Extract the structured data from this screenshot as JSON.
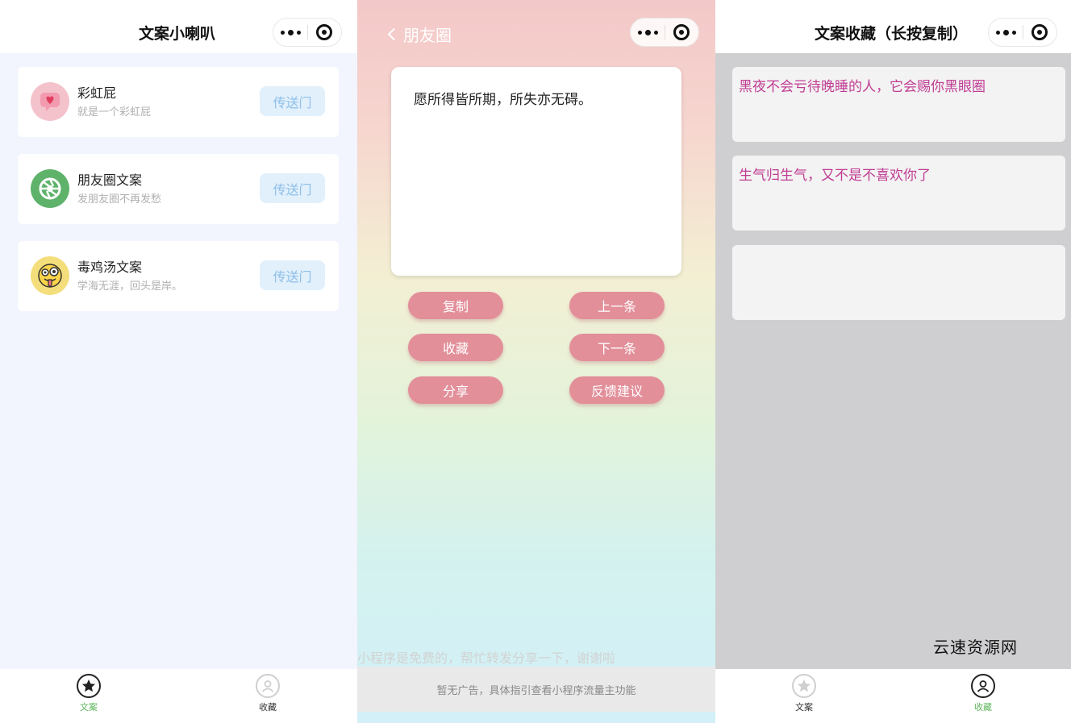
{
  "panel_home": {
    "nav_title": "文案小喇叭",
    "cards": [
      {
        "name": "彩虹屁",
        "desc": "就是一个彩虹屁",
        "button": "传送门",
        "icon": "heart-chat-icon"
      },
      {
        "name": "朋友圈文案",
        "desc": "发朋友圈不再发愁",
        "button": "传送门",
        "icon": "aperture-icon"
      },
      {
        "name": "毒鸡汤文案",
        "desc": "学海无涯，回头是岸。",
        "button": "传送门",
        "icon": "crazy-face-icon"
      }
    ],
    "tabs": [
      {
        "label": "文案",
        "icon": "star-circle-icon",
        "active": true
      },
      {
        "label": "收藏",
        "icon": "user-circle-icon",
        "active": false
      }
    ]
  },
  "panel_moments": {
    "back_label": "朋友圈",
    "quote": "愿所得皆所期，所失亦无碍。",
    "buttons": {
      "copy": "复制",
      "prev": "上一条",
      "favorite": "收藏",
      "next": "下一条",
      "share": "分享",
      "feedback": "反馈建议"
    },
    "share_hint": "小程序是免费的，帮忙转发分享一下，谢谢啦",
    "ad_text": "暂无广告，具体指引查看小程序流量主功能"
  },
  "panel_favorites": {
    "nav_title": "文案收藏（长按复制）",
    "items": [
      "黑夜不会亏待晚睡的人，它会赐你黑眼圈",
      "生气归生气，又不是不喜欢你了",
      ""
    ],
    "tabs": [
      {
        "label": "文案",
        "icon": "star-circle-icon",
        "active": false
      },
      {
        "label": "收藏",
        "icon": "user-circle-icon",
        "active": true
      }
    ],
    "watermark": "云速资源网"
  },
  "colors": {
    "accent_green": "#5eb65b",
    "pill_pink": "#e28f9a",
    "fav_text": "#c03c93",
    "go_button_bg": "#e2f0fc",
    "go_button_text": "#8cbfe8"
  }
}
